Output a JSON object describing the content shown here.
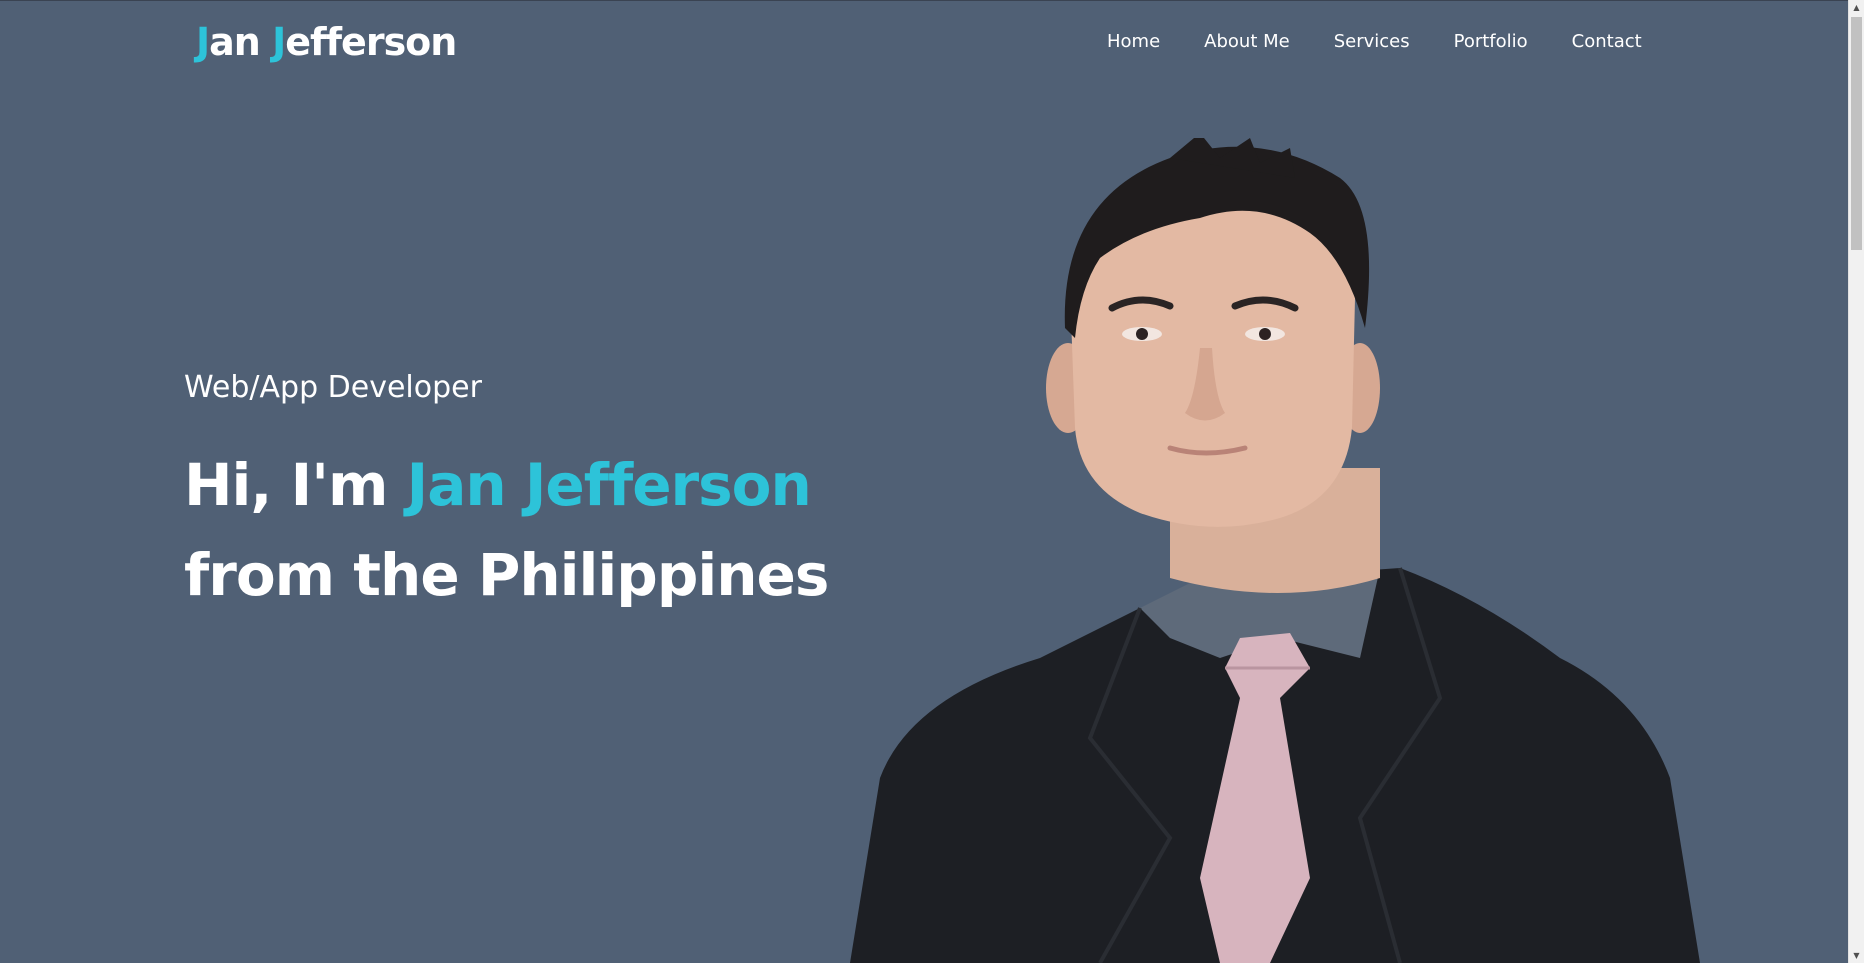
{
  "header": {
    "logo": {
      "first_initial": "J",
      "first_rest": "an ",
      "last_initial": "J",
      "last_rest": "efferson"
    },
    "nav": [
      {
        "label": "Home"
      },
      {
        "label": "About Me"
      },
      {
        "label": "Services"
      },
      {
        "label": "Portfolio"
      },
      {
        "label": "Contact"
      }
    ]
  },
  "hero": {
    "subtitle": "Web/App Developer",
    "greeting": "Hi, I'm ",
    "name": "Jan Jefferson",
    "line2": "from the Philippines",
    "portrait_alt": "portrait photo"
  },
  "colors": {
    "background": "#506075",
    "accent": "#2dc3d9",
    "text": "#ffffff"
  },
  "icons": {
    "scroll_up": "triangle-up-icon",
    "scroll_down": "triangle-down-icon"
  }
}
